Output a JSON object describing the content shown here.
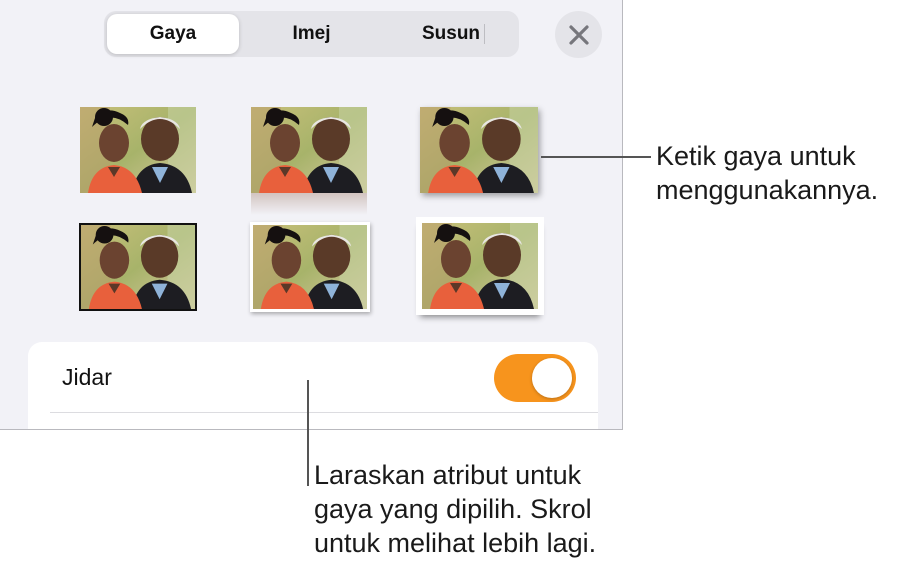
{
  "tabs": [
    {
      "label": "Gaya",
      "active": true
    },
    {
      "label": "Imej",
      "active": false
    },
    {
      "label": "Susun",
      "active": false
    }
  ],
  "close_icon": "close-icon",
  "styles": [
    {
      "name": "plain"
    },
    {
      "name": "reflection"
    },
    {
      "name": "shadow"
    },
    {
      "name": "thick-black-border"
    },
    {
      "name": "white-frame-shadow"
    },
    {
      "name": "curved-shadow"
    }
  ],
  "border_row": {
    "label": "Jidar",
    "toggle_on": true
  },
  "callouts": {
    "styles": "Ketik gaya untuk\nmenggunakannya.",
    "attributes": "Laraskan atribut untuk\ngaya yang dipilih. Skrol\nuntuk melihat lebih lagi."
  },
  "colors": {
    "accent": "#f7941d",
    "panel": "#f2f2f7"
  }
}
